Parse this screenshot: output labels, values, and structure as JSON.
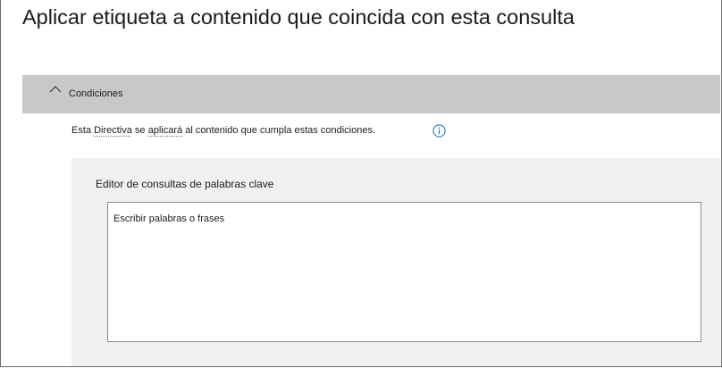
{
  "page": {
    "title": "Aplicar etiqueta a contenido que coincida con esta consulta"
  },
  "conditions_section": {
    "label": "Condiciones",
    "expanded": true,
    "chevron_icon": "chevron-up-icon",
    "description_part1": "Esta ",
    "description_dotted1": "Directiva",
    "description_part2": " se ",
    "description_dotted2": "aplicará",
    "description_part3": " al contenido que cumpla estas condiciones.",
    "info_icon": "info-icon",
    "accent_color": "#0f6cbd"
  },
  "keyword_editor": {
    "label": "Editor de consultas de palabras clave",
    "placeholder": "Escribir palabras o frases",
    "value": ""
  },
  "colors": {
    "header_bg": "#c8c8c8",
    "panel_bg": "#f0f0f0",
    "text": "#1b1b1b"
  }
}
